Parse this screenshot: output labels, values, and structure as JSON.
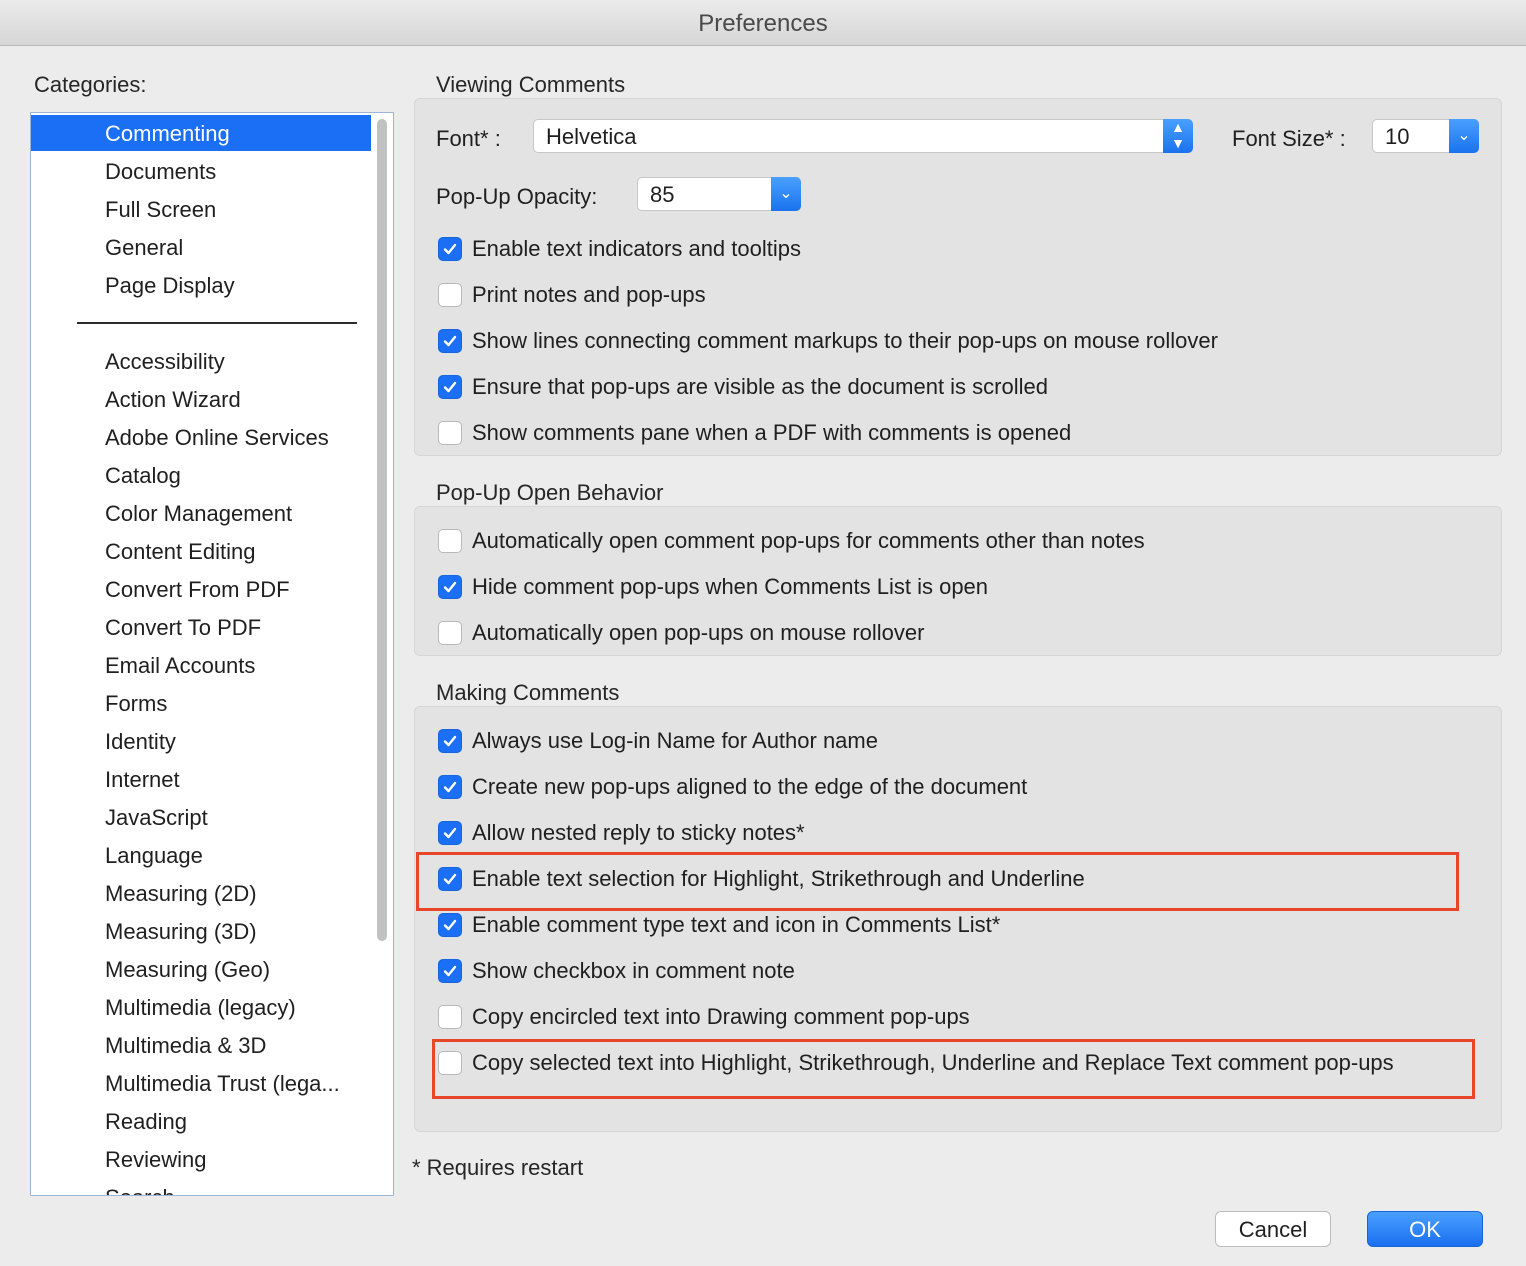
{
  "window": {
    "title": "Preferences"
  },
  "categories": {
    "label": "Categories:",
    "items": [
      {
        "label": "Commenting",
        "selected": true
      },
      {
        "label": "Documents"
      },
      {
        "label": "Full Screen"
      },
      {
        "label": "General"
      },
      {
        "label": "Page Display"
      },
      {
        "label": "Accessibility"
      },
      {
        "label": "Action Wizard"
      },
      {
        "label": "Adobe Online Services"
      },
      {
        "label": "Catalog"
      },
      {
        "label": "Color Management"
      },
      {
        "label": "Content Editing"
      },
      {
        "label": "Convert From PDF"
      },
      {
        "label": "Convert To PDF"
      },
      {
        "label": "Email Accounts"
      },
      {
        "label": "Forms"
      },
      {
        "label": "Identity"
      },
      {
        "label": "Internet"
      },
      {
        "label": "JavaScript"
      },
      {
        "label": "Language"
      },
      {
        "label": "Measuring (2D)"
      },
      {
        "label": "Measuring (3D)"
      },
      {
        "label": "Measuring (Geo)"
      },
      {
        "label": "Multimedia (legacy)"
      },
      {
        "label": "Multimedia & 3D"
      },
      {
        "label": "Multimedia Trust (lega..."
      },
      {
        "label": "Reading"
      },
      {
        "label": "Reviewing"
      },
      {
        "label": "Search"
      }
    ]
  },
  "viewing": {
    "title": "Viewing Comments",
    "font_label": "Font* :",
    "font_value": "Helvetica",
    "font_size_label": "Font Size* :",
    "font_size_value": "10",
    "opacity_label": "Pop-Up Opacity:",
    "opacity_value": "85",
    "options": [
      {
        "label": "Enable text indicators and tooltips",
        "checked": true
      },
      {
        "label": "Print notes and pop-ups",
        "checked": false
      },
      {
        "label": "Show lines connecting comment markups to their pop-ups on mouse rollover",
        "checked": true
      },
      {
        "label": "Ensure that pop-ups are visible as the document is scrolled",
        "checked": true
      },
      {
        "label": "Show comments pane when a PDF with comments is opened",
        "checked": false
      }
    ]
  },
  "popup": {
    "title": "Pop-Up Open Behavior",
    "options": [
      {
        "label": "Automatically open comment pop-ups for comments other than notes",
        "checked": false
      },
      {
        "label": "Hide comment pop-ups when Comments List is open",
        "checked": true
      },
      {
        "label": "Automatically open pop-ups on mouse rollover",
        "checked": false
      }
    ]
  },
  "making": {
    "title": "Making Comments",
    "options": [
      {
        "label": "Always use Log-in Name for Author name",
        "checked": true
      },
      {
        "label": "Create new pop-ups aligned to the edge of the document",
        "checked": true
      },
      {
        "label": "Allow nested reply to sticky notes*",
        "checked": true
      },
      {
        "label": "Enable text selection for Highlight, Strikethrough and Underline",
        "checked": true
      },
      {
        "label": "Enable comment type text and icon in Comments List*",
        "checked": true
      },
      {
        "label": "Show checkbox in comment note",
        "checked": true
      },
      {
        "label": "Copy encircled text into Drawing comment pop-ups",
        "checked": false
      },
      {
        "label": "Copy selected text into Highlight, Strikethrough, Underline and Replace Text comment pop-ups",
        "checked": false
      }
    ]
  },
  "footnote": "* Requires restart",
  "buttons": {
    "cancel": "Cancel",
    "ok": "OK"
  },
  "colors": {
    "accent": "#1b6ff5",
    "annotation": "#e8462a"
  }
}
